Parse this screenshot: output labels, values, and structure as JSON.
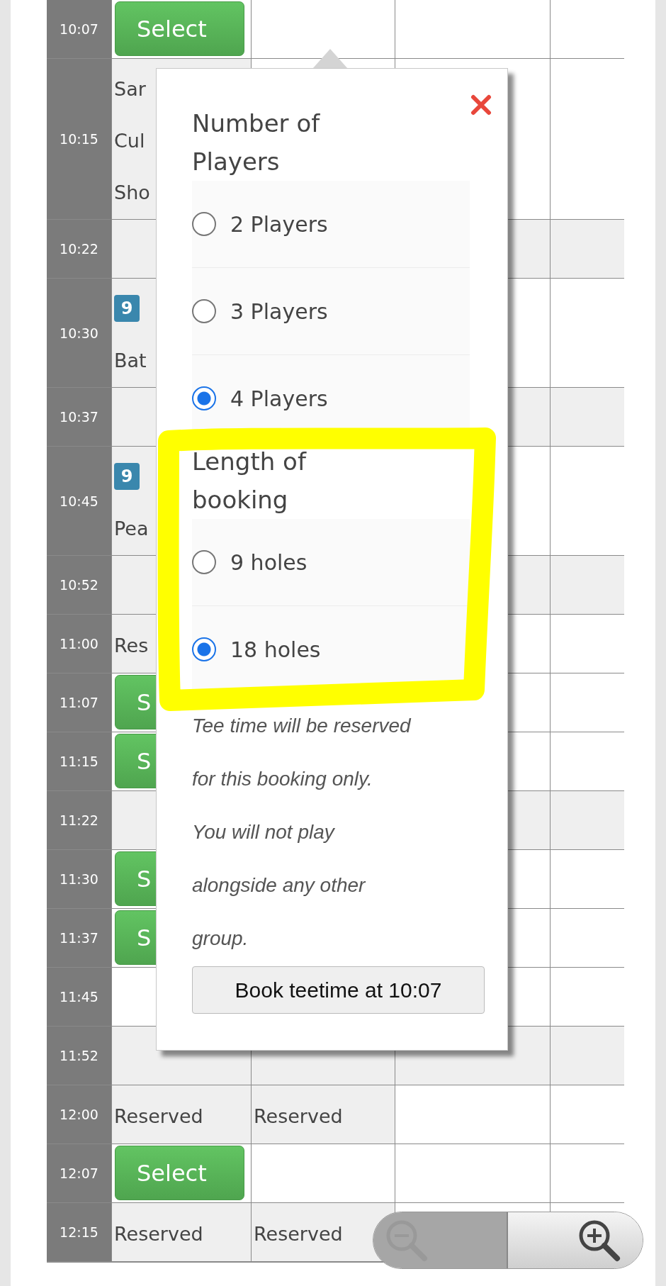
{
  "rows": [
    {
      "time": "10:07",
      "cells": [
        {
          "kind": "select",
          "label": "Select"
        },
        {
          "kind": "empty"
        },
        {
          "kind": "empty"
        },
        {
          "kind": "empty"
        }
      ]
    },
    {
      "time": "10:15",
      "cells": [
        {
          "kind": "text",
          "lines": [
            {
              "text": "Sar"
            },
            {
              "text": "Cul"
            },
            {
              "text": "Sho"
            }
          ]
        },
        {
          "kind": "empty"
        },
        {
          "kind": "empty"
        },
        {
          "kind": "empty"
        }
      ]
    },
    {
      "time": "10:22",
      "cells": [
        {
          "kind": "blank"
        },
        {
          "kind": "empty"
        },
        {
          "kind": "blank"
        },
        {
          "kind": "blank"
        }
      ]
    },
    {
      "time": "10:30",
      "cells": [
        {
          "kind": "text",
          "lines": [
            {
              "badge": "9"
            },
            {
              "text": "Bat"
            }
          ]
        },
        {
          "kind": "empty"
        },
        {
          "kind": "empty"
        },
        {
          "kind": "empty"
        }
      ]
    },
    {
      "time": "10:37",
      "cells": [
        {
          "kind": "blank"
        },
        {
          "kind": "empty"
        },
        {
          "kind": "blank"
        },
        {
          "kind": "blank"
        }
      ]
    },
    {
      "time": "10:45",
      "cells": [
        {
          "kind": "text",
          "lines": [
            {
              "badge": "9"
            },
            {
              "text": "Pea"
            }
          ]
        },
        {
          "kind": "empty"
        },
        {
          "kind": "empty"
        },
        {
          "kind": "empty"
        }
      ]
    },
    {
      "time": "10:52",
      "cells": [
        {
          "kind": "blank"
        },
        {
          "kind": "empty"
        },
        {
          "kind": "blank"
        },
        {
          "kind": "blank"
        }
      ]
    },
    {
      "time": "11:00",
      "cells": [
        {
          "kind": "text",
          "lines": [
            {
              "text": "Res"
            }
          ]
        },
        {
          "kind": "empty"
        },
        {
          "kind": "empty"
        },
        {
          "kind": "empty"
        }
      ]
    },
    {
      "time": "11:07",
      "cells": [
        {
          "kind": "select",
          "label": "S"
        },
        {
          "kind": "empty"
        },
        {
          "kind": "empty"
        },
        {
          "kind": "empty"
        }
      ]
    },
    {
      "time": "11:15",
      "cells": [
        {
          "kind": "select",
          "label": "S"
        },
        {
          "kind": "empty"
        },
        {
          "kind": "empty"
        },
        {
          "kind": "empty"
        }
      ]
    },
    {
      "time": "11:22",
      "cells": [
        {
          "kind": "blank"
        },
        {
          "kind": "empty"
        },
        {
          "kind": "blank"
        },
        {
          "kind": "blank"
        }
      ]
    },
    {
      "time": "11:30",
      "cells": [
        {
          "kind": "select",
          "label": "S"
        },
        {
          "kind": "empty"
        },
        {
          "kind": "empty"
        },
        {
          "kind": "empty"
        }
      ]
    },
    {
      "time": "11:37",
      "cells": [
        {
          "kind": "select",
          "label": "S"
        },
        {
          "kind": "empty"
        },
        {
          "kind": "empty"
        },
        {
          "kind": "empty"
        }
      ]
    },
    {
      "time": "11:45",
      "cells": [
        {
          "kind": "empty"
        },
        {
          "kind": "empty"
        },
        {
          "kind": "empty"
        },
        {
          "kind": "empty"
        }
      ]
    },
    {
      "time": "11:52",
      "cells": [
        {
          "kind": "blank"
        },
        {
          "kind": "blank"
        },
        {
          "kind": "blank"
        },
        {
          "kind": "blank"
        }
      ]
    },
    {
      "time": "12:00",
      "cells": [
        {
          "kind": "text",
          "lines": [
            {
              "text": "Reserved"
            }
          ]
        },
        {
          "kind": "text",
          "lines": [
            {
              "text": "Reserved"
            }
          ]
        },
        {
          "kind": "empty"
        },
        {
          "kind": "empty"
        }
      ]
    },
    {
      "time": "12:07",
      "cells": [
        {
          "kind": "select",
          "label": "Select"
        },
        {
          "kind": "empty"
        },
        {
          "kind": "empty"
        },
        {
          "kind": "empty"
        }
      ]
    },
    {
      "time": "12:15",
      "cells": [
        {
          "kind": "text",
          "lines": [
            {
              "text": "Reserved"
            }
          ]
        },
        {
          "kind": "text",
          "lines": [
            {
              "text": "Reserved"
            }
          ]
        },
        {
          "kind": "empty"
        },
        {
          "kind": "empty"
        }
      ]
    }
  ],
  "popup": {
    "groups": [
      {
        "heading": "Number of Players",
        "options": [
          {
            "label": "2 Players",
            "selected": false
          },
          {
            "label": "3 Players",
            "selected": false
          },
          {
            "label": "4 Players",
            "selected": true
          }
        ]
      },
      {
        "heading": "Length of booking",
        "options": [
          {
            "label": "9 holes",
            "selected": false
          },
          {
            "label": "18 holes",
            "selected": true
          }
        ]
      }
    ],
    "notes": [
      "Tee time will be reserved for this booking only.",
      "You will not play alongside any other group."
    ],
    "button": "Book teetime at 10:07"
  }
}
